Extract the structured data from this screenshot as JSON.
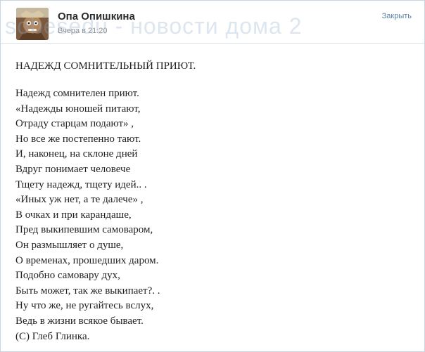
{
  "post": {
    "author": "Опа Опишкина",
    "time": "Вчера в 21:20",
    "close_label": "Закрыть",
    "watermark": "sobesedu - новости дома 2"
  },
  "poem": {
    "title": "НАДЕЖД СОМНИТЕЛЬНЫЙ ПРИЮТ.",
    "lines": [
      "Надежд сомнителен приют.",
      "«Надежды юношей питают,",
      "Отраду старцам подают» ,",
      "Но все же постепенно тают.",
      "И, наконец, на склоне дней",
      "Вдруг понимает человече",
      "Тщету надежд, тщету идей.. .",
      "«Иных уж нет, а те далече» ,",
      "В очках и при карандаше,",
      "Пред выкипевшим самоваром,",
      "Он размышляет о душе,",
      "О временах, прошедших даром.",
      "Подобно самовару дух,",
      "Быть может, так же выкипает?. .",
      "Ну что же, не ругайтесь вслух,",
      "Ведь в жизни всякое бывает.",
      "(С) Глеб Глинка."
    ]
  },
  "icons": {
    "avatar": "user-avatar-photo"
  },
  "colors": {
    "link": "#5a7fa8",
    "time": "#8f8f8f",
    "border": "#c9d5e1"
  }
}
